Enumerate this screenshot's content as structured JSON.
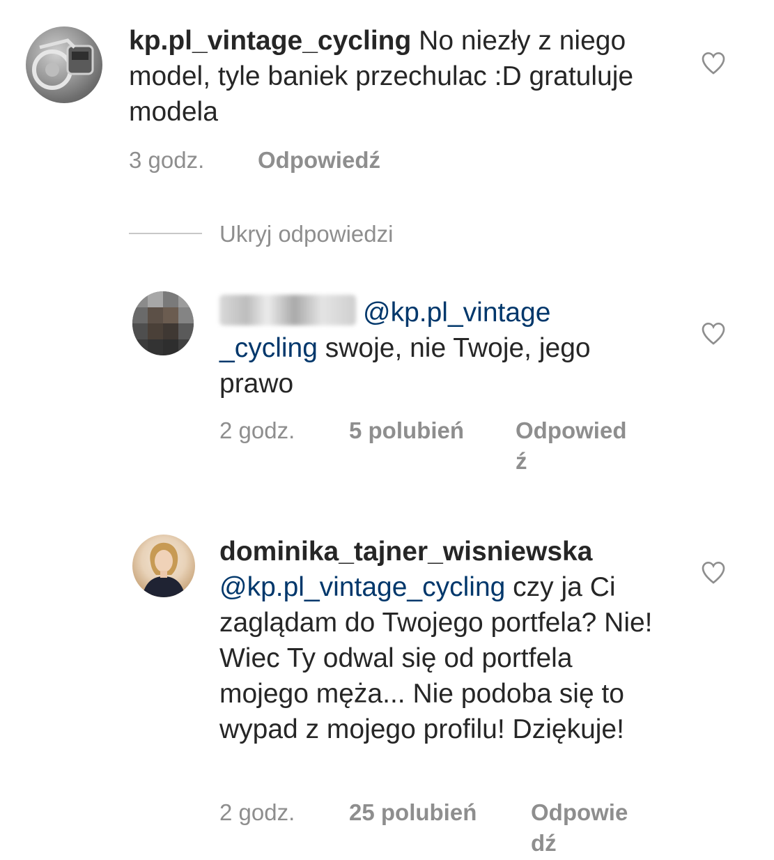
{
  "comments": [
    {
      "username": "kp.pl_vintage_cycling",
      "text": " No niezły z niego model, tyle baniek przechulac :D gratuluje modela",
      "time": "3 godz.",
      "reply_label": "Odpowiedź",
      "avatar_icon": "bicycle-parts-avatar"
    },
    {
      "username": "",
      "username_blurred": true,
      "mention": "@kp.pl_vintage _cycling",
      "text": "  swoje, nie Twoje, jego prawo",
      "time": "2 godz.",
      "likes": "5 polubień",
      "reply_label": "Odpowied ź",
      "avatar_icon": "pixelated-avatar"
    },
    {
      "username": "dominika_tajner_wisniewska",
      "mention": "@kp.pl_vintage_cycling",
      "text": " czy ja Ci zaglądam do Twojego portfela? Nie! Wiec Ty odwal się od portfela mojego męża... Nie podoba się to wypad z mojego profilu! Dziękuje!",
      "time": "2 godz.",
      "likes": "25 polubień",
      "reply_label": "Odpowie dź",
      "avatar_icon": "woman-portrait-avatar"
    }
  ],
  "hide_replies_label": "Ukryj odpowiedzi",
  "colors": {
    "text": "#262626",
    "meta": "#8e8e8e",
    "mention": "#00376b",
    "divider": "#c7c7c7"
  },
  "icons": {
    "like": "heart-outline-icon"
  }
}
